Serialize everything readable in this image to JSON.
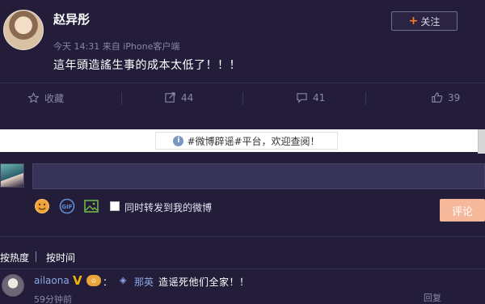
{
  "post": {
    "username": "赵异彤",
    "time": "今天 14:31",
    "source_prefix": "来自",
    "source": "iPhone客户端",
    "text": "這年頭造謠生事的成本太低了！！！",
    "follow_label": "关注"
  },
  "actions": {
    "favorite_label": "收藏",
    "repost_count": "44",
    "comment_count": "41",
    "like_count": "39"
  },
  "notice": {
    "text": "#微博辟谣#平台，欢迎查阅！"
  },
  "composer": {
    "input_value": "",
    "forward_label": "同时转发到我的微博",
    "comment_button": "评论"
  },
  "sort": {
    "hot_label": "按热度",
    "time_label": "按时间"
  },
  "comment": {
    "username": "ailaona",
    "colon": "：",
    "mention": "那英",
    "text": "造谣死他们全家！！",
    "time": "59分钟前",
    "reply_label": "回复"
  },
  "colors": {
    "background": "#231d3a",
    "accent_orange": "#ff7b20",
    "link_blue": "#8ba7e6",
    "button_peach": "#f5b89a"
  }
}
